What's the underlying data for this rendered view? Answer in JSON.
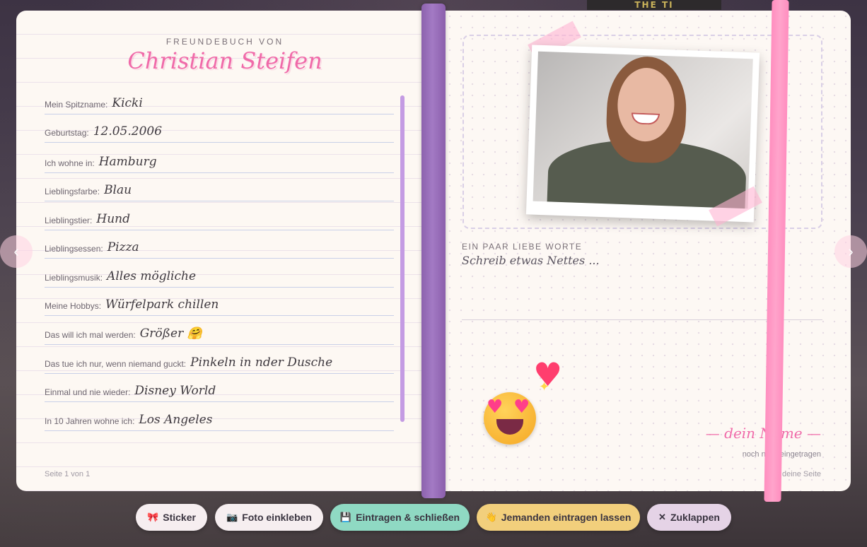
{
  "background": {
    "sign_text": "THE TI"
  },
  "left_page": {
    "kicker": "FREUNDEBUCH VON",
    "owner_name": "Christian Steifen",
    "page_number": "Seite 1 von 1",
    "fields": [
      {
        "label": "Mein Spitzname:",
        "value": "Kicki"
      },
      {
        "label": "Geburtstag:",
        "value": "12.05.2006"
      },
      {
        "label": "Ich wohne in:",
        "value": "Hamburg"
      },
      {
        "label": "Lieblingsfarbe:",
        "value": "Blau"
      },
      {
        "label": "Lieblingstier:",
        "value": "Hund"
      },
      {
        "label": "Lieblingsessen:",
        "value": "Pizza"
      },
      {
        "label": "Lieblingsmusik:",
        "value": "Alles mögliche"
      },
      {
        "label": "Meine Hobbys:",
        "value": "Würfelpark chillen"
      },
      {
        "label": "Das will ich mal werden:",
        "value": "Größer 🤗"
      },
      {
        "label": "Das tue ich nur, wenn niemand guckt:",
        "value": "Pinkeln in nder Dusche"
      },
      {
        "label": "Einmal und nie wieder:",
        "value": "Disney World"
      },
      {
        "label": "In 10 Jahren wohne ich:",
        "value": "Los Angeles"
      }
    ]
  },
  "right_page": {
    "words_label": "EIN PAAR LIEBE WORTE",
    "words_placeholder": "Schreib etwas Nettes ...",
    "signature_name": "— dein Name —",
    "signature_status": "noch nicht eingetragen",
    "page_owner": "deine Seite",
    "stickers": [
      "heart-eyes-emoji",
      "sparkling-heart-emoji"
    ]
  },
  "navigation": {
    "prev": "‹",
    "next": "›"
  },
  "toolbar": {
    "sticker": {
      "icon": "🎀",
      "label": "Sticker"
    },
    "photo": {
      "icon": "📷",
      "label": "Foto einkleben"
    },
    "save": {
      "icon": "💾",
      "label": "Eintragen & schließen"
    },
    "invite": {
      "icon": "👋",
      "label": "Jemanden eintragen lassen"
    },
    "close": {
      "icon": "✕",
      "label": "Zuklappen"
    }
  },
  "colors": {
    "accent_pink": "#f06aa9",
    "spine": "#a37ac4",
    "ribbon": "#ff9ac6",
    "save_green": "#8fd9c3",
    "invite_yellow": "#f2cf7c"
  }
}
